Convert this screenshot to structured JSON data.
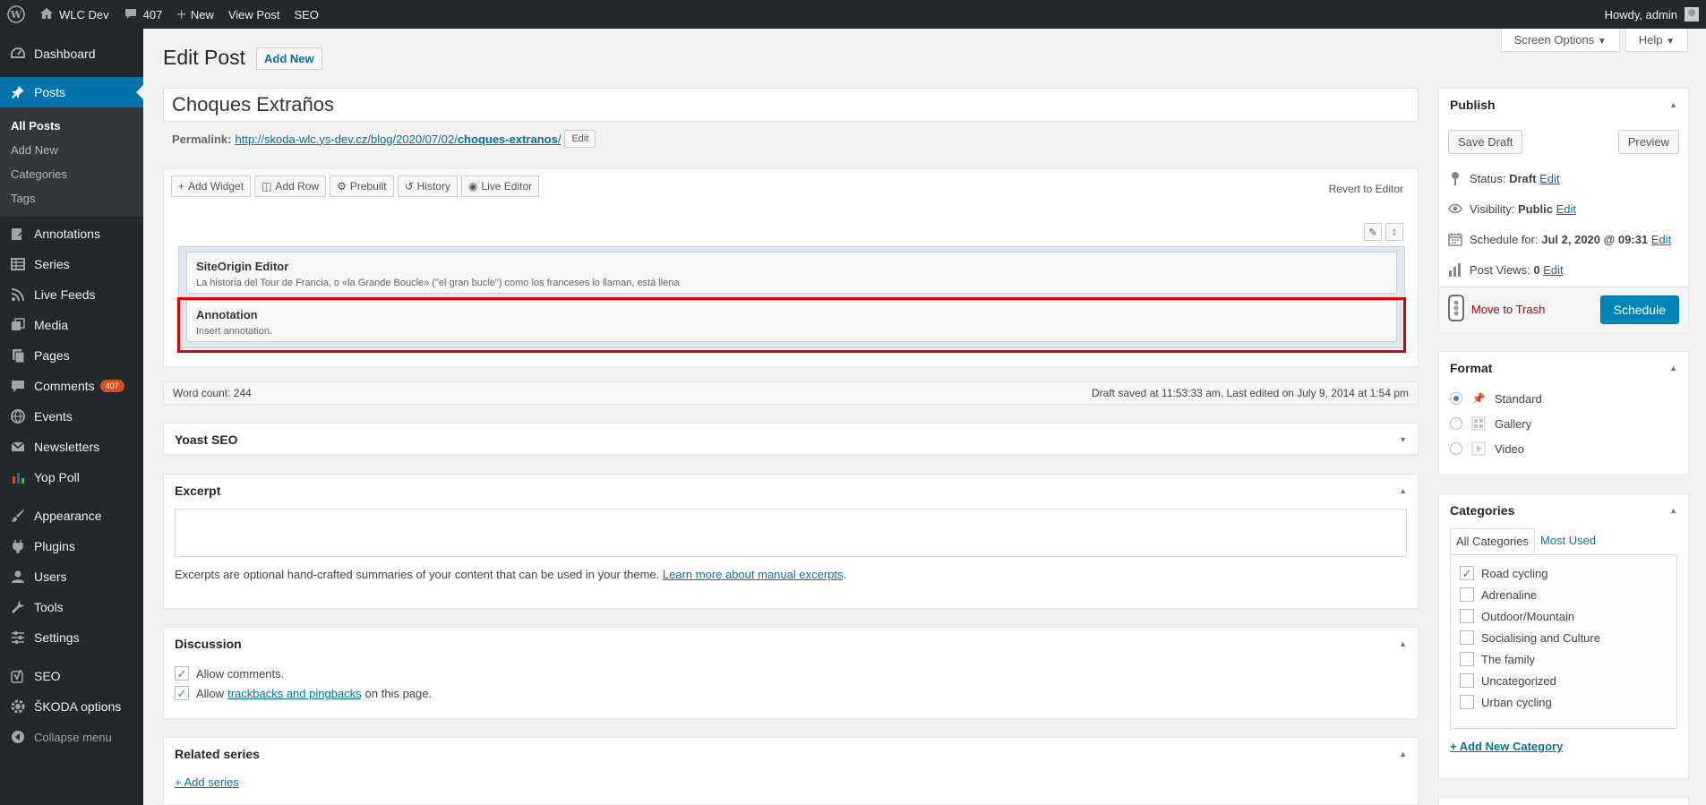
{
  "adminbar": {
    "site_name": "WLC Dev",
    "comments_count": "407",
    "new_label": "New",
    "view_post": "View Post",
    "seo": "SEO",
    "howdy": "Howdy, admin"
  },
  "menu": {
    "dashboard": "Dashboard",
    "posts": "Posts",
    "posts_sub": [
      "All Posts",
      "Add New",
      "Categories",
      "Tags"
    ],
    "annotations": "Annotations",
    "series": "Series",
    "live_feeds": "Live Feeds",
    "media": "Media",
    "pages": "Pages",
    "comments": "Comments",
    "comments_badge": "407",
    "events": "Events",
    "newsletters": "Newsletters",
    "yop_poll": "Yop Poll",
    "appearance": "Appearance",
    "plugins": "Plugins",
    "users": "Users",
    "tools": "Tools",
    "settings": "Settings",
    "seo": "SEO",
    "skoda_options": "ŠKODA options",
    "collapse": "Collapse menu"
  },
  "screen_options": "Screen Options",
  "help": "Help",
  "page_title": "Edit Post",
  "add_new": "Add New",
  "post_title": "Choques Extraños",
  "permalink": {
    "label": "Permalink:",
    "url_base": "http://skoda-wlc.ys-dev.cz/blog/2020/07/02/",
    "slug": "choques-extranos",
    "url_end": "/",
    "edit": "Edit"
  },
  "builder": {
    "toolbar": [
      "Add Widget",
      "Add Row",
      "Prebuilt",
      "History",
      "Live Editor"
    ],
    "revert": "Revert to Editor",
    "widgets": [
      {
        "title": "SiteOrigin Editor",
        "desc": "La historia del Tour de Francia, o «la Grande Boucle» (\"el gran bucle\") como los franceses lo llaman, está llena"
      },
      {
        "title": "Annotation",
        "desc": "Insert annotation."
      }
    ]
  },
  "status": {
    "word_count": "Word count: 244",
    "draft_saved": "Draft saved at 11:53:33 am. Last edited on July 9, 2014 at 1:54 pm"
  },
  "yoast": "Yoast SEO",
  "excerpt": {
    "title": "Excerpt",
    "note": "Excerpts are optional hand-crafted summaries of your content that can be used in your theme.",
    "link": "Learn more about manual excerpts",
    "period": "."
  },
  "discussion": {
    "title": "Discussion",
    "allow_comments": "Allow comments.",
    "allow_prefix": "Allow",
    "trackbacks_link": "trackbacks and pingbacks",
    "allow_suffix": "on this page."
  },
  "related_series": {
    "title": "Related series",
    "add": "+ Add series"
  },
  "publish": {
    "title": "Publish",
    "save_draft": "Save Draft",
    "preview": "Preview",
    "status_label": "Status:",
    "status_value": "Draft",
    "visibility_label": "Visibility:",
    "visibility_value": "Public",
    "schedule_label": "Schedule for:",
    "schedule_value": "Jul 2, 2020 @ 09:31",
    "views_label": "Post Views:",
    "views_value": "0",
    "edit": "Edit",
    "trash": "Move to Trash",
    "schedule_btn": "Schedule"
  },
  "format": {
    "title": "Format",
    "options": [
      "Standard",
      "Gallery",
      "Video"
    ]
  },
  "categories": {
    "title": "Categories",
    "tab_all": "All Categories",
    "tab_used": "Most Used",
    "items": [
      "Road cycling",
      "Adrenaline",
      "Outdoor/Mountain",
      "Socialising and Culture",
      "The family",
      "Uncategorized",
      "Urban cycling"
    ],
    "add_new": "+ Add New Category"
  }
}
